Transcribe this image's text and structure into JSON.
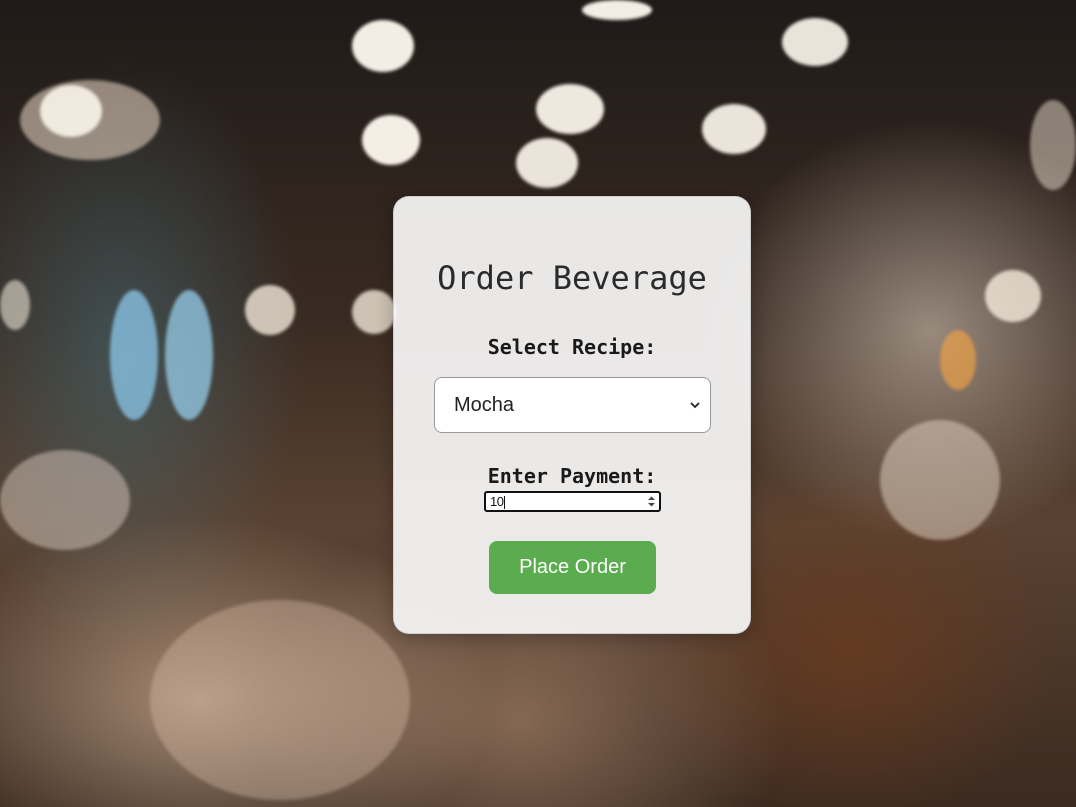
{
  "order_form": {
    "title": "Order Beverage",
    "recipe_label": "Select Recipe:",
    "recipe_selected": "Mocha",
    "payment_label": "Enter Payment:",
    "payment_value": "10",
    "submit_label": "Place Order"
  },
  "colors": {
    "button_bg": "#5aac4e",
    "button_text": "#ffffff",
    "card_bg": "#f8f8f8"
  },
  "icons": {
    "select_arrow": "chevron-down-icon",
    "number_spinner": "spinner-arrows-icon"
  }
}
